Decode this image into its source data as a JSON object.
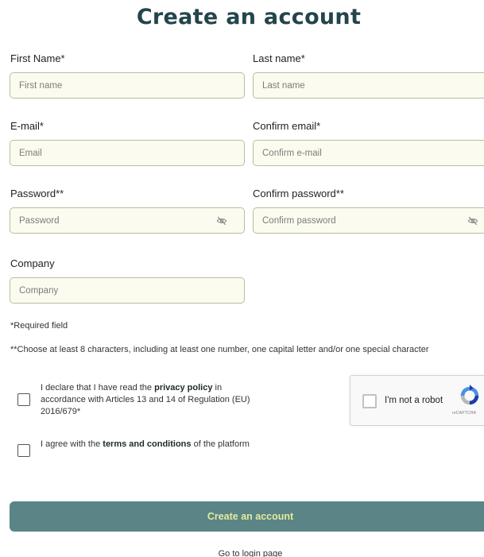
{
  "page": {
    "title": "Create an account"
  },
  "fields": {
    "first_name": {
      "label": "First Name*",
      "placeholder": "First name"
    },
    "last_name": {
      "label": "Last name*",
      "placeholder": "Last name"
    },
    "email": {
      "label": "E-mail*",
      "placeholder": "Email"
    },
    "confirm_email": {
      "label": "Confirm email*",
      "placeholder": "Confirm e-mail"
    },
    "password": {
      "label": "Password**",
      "placeholder": "Password"
    },
    "confirm_password": {
      "label": "Confirm password**",
      "placeholder": "Confirm password"
    },
    "company": {
      "label": "Company",
      "placeholder": "Company"
    }
  },
  "notes": {
    "required": "*Required field",
    "password_rule": "**Choose at least 8 characters, including at least one number, one capital letter and/or one special character"
  },
  "consents": {
    "privacy": {
      "prefix": "I declare that I have read the ",
      "link": "privacy policy",
      "suffix": " in accordance with Articles 13 and 14 of Regulation (EU) 2016/679*",
      "checked": false
    },
    "terms": {
      "prefix": "I agree with the ",
      "link": "terms and conditions",
      "suffix": " of the platform",
      "checked": false
    }
  },
  "recaptcha": {
    "label": "I'm not a robot",
    "brand": "reCAPTCHA"
  },
  "actions": {
    "submit_label": "Create an account",
    "login_link": "Go to login page"
  },
  "colors": {
    "title": "#23454b",
    "input_bg": "#fbfcef",
    "input_border": "#b9bd9f",
    "button_bg": "#5a8486",
    "button_text": "#e6ea9a"
  },
  "icons": {
    "password_toggle": "eye-slash-icon",
    "recaptcha_logo": "recaptcha-logo-icon"
  }
}
